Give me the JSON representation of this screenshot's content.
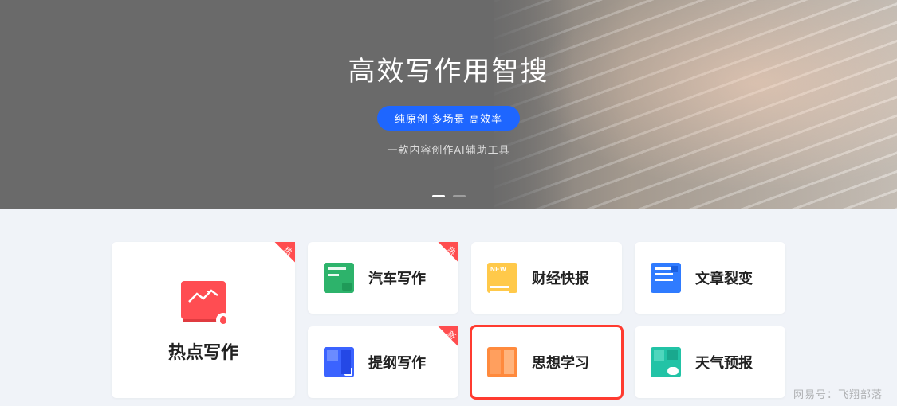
{
  "hero": {
    "title": "高效写作用智搜",
    "pill": "纯原创 多场景 高效率",
    "subtitle": "一款内容创作AI辅助工具"
  },
  "badges": {
    "hot": "热",
    "new": "新"
  },
  "cards": {
    "hotspot": "热点写作",
    "car": "汽车写作",
    "finance": "财经快报",
    "split": "文章裂变",
    "outline": "提纲写作",
    "thought": "思想学习",
    "weather": "天气预报"
  },
  "watermark": "网易号：飞翔部落",
  "colors": {
    "accent": "#1e66ff",
    "hot_badge": "#ff4d4f",
    "highlight": "#ff3b30"
  }
}
